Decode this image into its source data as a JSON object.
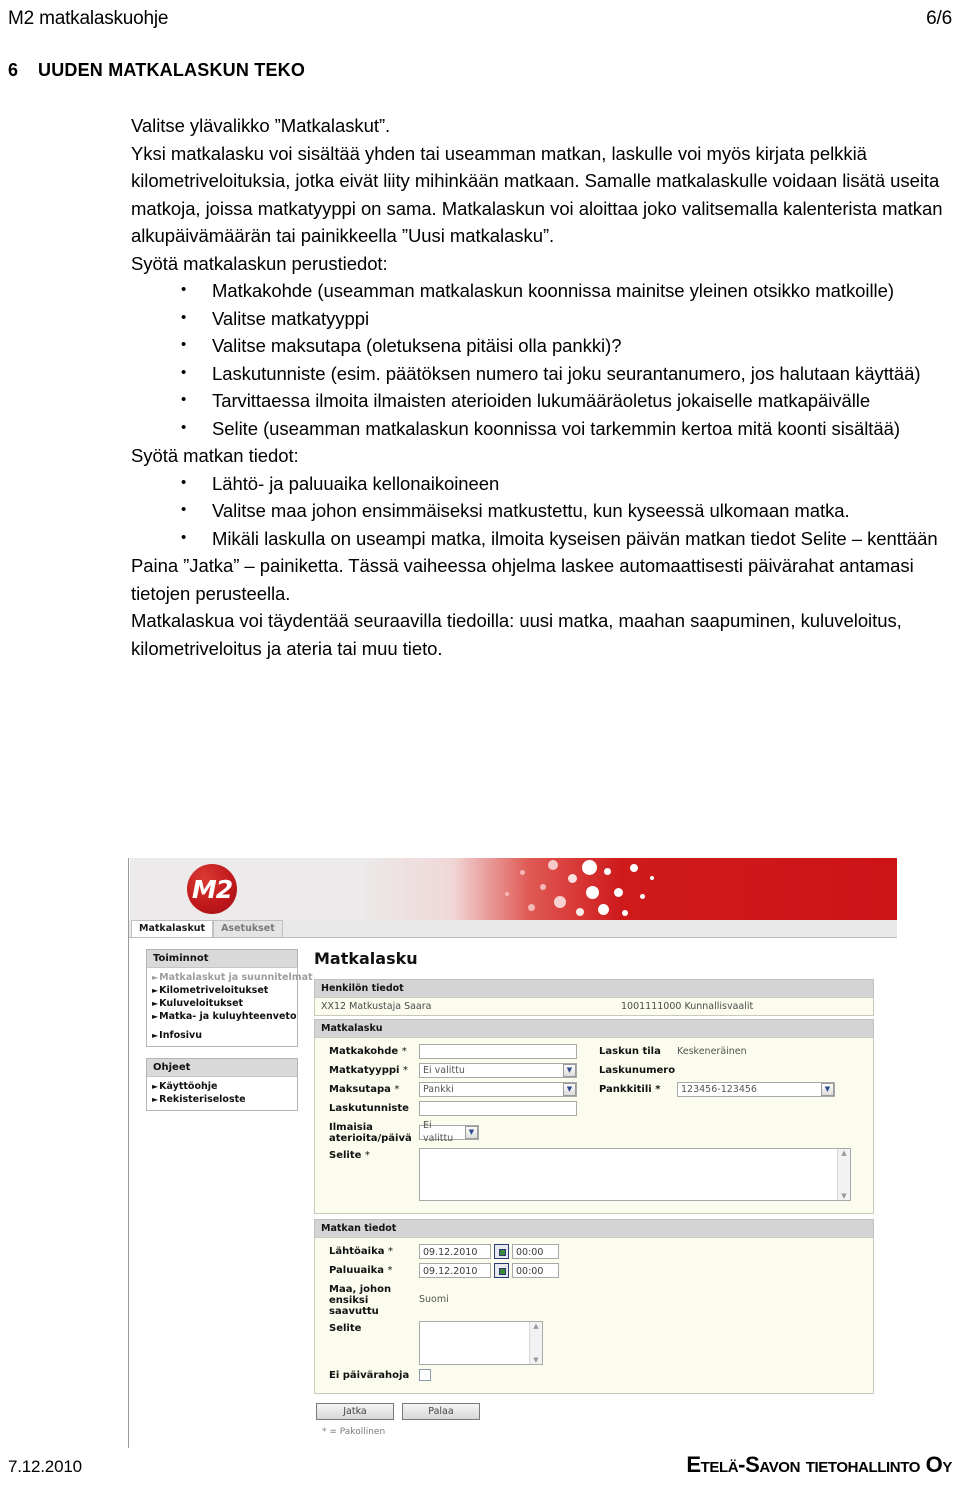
{
  "header": {
    "doc_title": "M2 matkalaskuohje",
    "page_number": "6/6"
  },
  "section": {
    "number": "6",
    "title": "UUDEN MATKALASKUN TEKO"
  },
  "body": {
    "p1": "Valitse ylävalikko ”Matkalaskut”.",
    "p2": "Yksi matkalasku voi sisältää yhden tai useamman matkan, laskulle voi myös kirjata pelkkiä kilometriveloituksia, jotka eivät liity mihinkään matkaan. Samalle matkalaskulle voidaan lisätä useita matkoja, joissa matkatyyppi on sama. Matkalaskun voi aloittaa joko valitsemalla kalenterista matkan alkupäivämäärän tai painikkeella ”Uusi matkalasku”.",
    "p3": "Syötä matkalaskun perustiedot:",
    "bullets1": [
      "Matkakohde (useamman matkalaskun koonnissa mainitse yleinen otsikko matkoille)",
      "Valitse matkatyyppi",
      "Valitse maksutapa (oletuksena pitäisi olla pankki)?",
      "Laskutunniste (esim. päätöksen numero tai joku seurantanumero, jos halutaan käyttää)",
      "Tarvittaessa ilmoita ilmaisten aterioiden lukumääräoletus jokaiselle matkapäivälle",
      "Selite (useamman matkalaskun koonnissa voi tarkemmin kertoa mitä koonti sisältää)"
    ],
    "p4": "Syötä matkan tiedot:",
    "bullets2": [
      "Lähtö- ja paluuaika kellonaikoineen",
      "Valitse maa johon ensimmäiseksi matkustettu, kun kyseessä ulkomaan matka.",
      "Mikäli laskulla on useampi matka, ilmoita kyseisen päivän matkan tiedot Selite – kenttään"
    ],
    "p5": "Paina ”Jatka” – painiketta.  Tässä vaiheessa ohjelma laskee automaattisesti päivärahat antamasi tietojen perusteella.",
    "p6": "Matkalaskua voi täydentää seuraavilla tiedoilla: uusi matka, maahan saapuminen, kuluveloitus, kilometriveloitus ja ateria tai muu tieto."
  },
  "app": {
    "logo_text": "M2",
    "tabs": [
      {
        "label": "Matkalaskut",
        "active": true
      },
      {
        "label": "Asetukset",
        "active": false
      }
    ],
    "nav": [
      {
        "title": "Toiminnot",
        "items": [
          {
            "label": "Matkalaskut ja suunnitelmat",
            "muted": true
          },
          {
            "label": "Kilometriveloitukset",
            "muted": false
          },
          {
            "label": "Kuluveloitukset",
            "muted": false
          },
          {
            "label": "Matka- ja kuluyhteenveto",
            "muted": false
          },
          {
            "label": "Infosivu",
            "muted": false,
            "gap_before": true
          }
        ]
      },
      {
        "title": "Ohjeet",
        "items": [
          {
            "label": "Käyttöohje",
            "muted": false
          },
          {
            "label": "Rekisteriseloste",
            "muted": false
          }
        ]
      }
    ],
    "form": {
      "title": "Matkalasku",
      "person_panel_title": "Henkilön tiedot",
      "person_name": "XX12 Matkustaja Saara",
      "person_cost_center": "1001111000 Kunnallisvaalit",
      "invoice_panel_title": "Matkalasku",
      "labels": {
        "destination": "Matkakohde",
        "trip_type": "Matkatyyppi",
        "payment_method": "Maksutapa",
        "invoice_id": "Laskutunniste",
        "free_meals": "Ilmaisia aterioita/päivä",
        "free_meals_l1": "Ilmaisia",
        "free_meals_l2": "aterioita/päivä",
        "description": "Selite",
        "invoice_status": "Laskun tila",
        "invoice_number": "Laskunumero",
        "bank_account": "Pankkitili"
      },
      "values": {
        "destination": "",
        "trip_type": "Ei valittu",
        "payment_method": "Pankki",
        "invoice_id": "",
        "free_meals": "Ei valittu",
        "description": "",
        "invoice_status": "Keskeneräinen",
        "invoice_number": "",
        "bank_account": "123456-123456"
      },
      "trip_panel_title": "Matkan tiedot",
      "trip_labels": {
        "departure": "Lähtöaika",
        "return": "Paluuaika",
        "country": "Maa, johon ensiksi saavuttu",
        "country_l1": "Maa, johon",
        "country_l2": "ensiksi",
        "country_l3": "saavuttu",
        "description": "Selite",
        "no_allowance": "Ei päivärahoja"
      },
      "trip_values": {
        "departure_date": "09.12.2010",
        "departure_time": "00:00",
        "return_date": "09.12.2010",
        "return_time": "00:00",
        "country": "Suomi",
        "description": ""
      },
      "required_marker": "*",
      "buttons": {
        "continue": "Jatka",
        "back": "Palaa"
      },
      "legend": "* = Pakollinen"
    }
  },
  "footer": {
    "date": "7.12.2010",
    "company": "Etelä-Savon tietohallinto Oy"
  },
  "colors": {
    "brand_red": "#cc1417",
    "panel_bg": "#fbfbee",
    "panel_header": "#d4d4d4"
  }
}
